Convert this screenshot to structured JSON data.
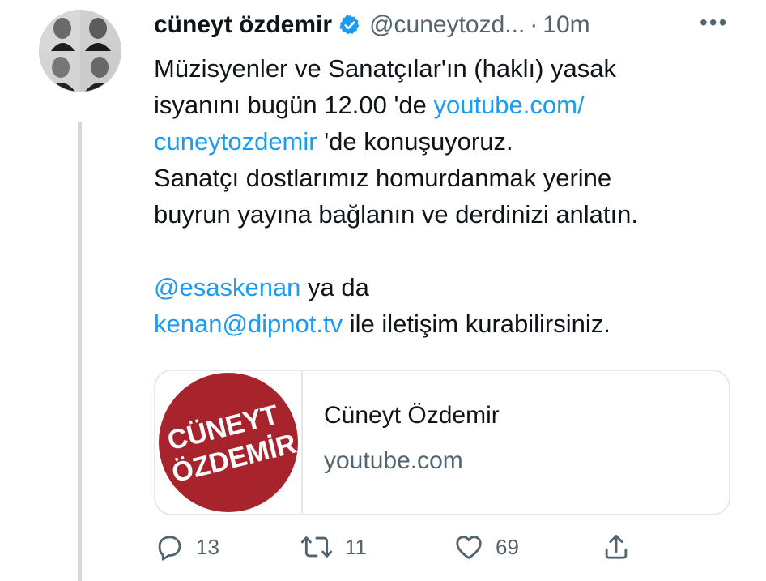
{
  "tweet": {
    "name": "cüneyt özdemir",
    "handle": "@cuneytozd...",
    "separator": "·",
    "time": "10m",
    "more": "•••",
    "text": {
      "l1": "Müzisyenler ve Sanatçılar'ın (haklı) yasak",
      "l2_pre": "isyanını bugün 12.00 'de ",
      "l2_link": "youtube.com/",
      "l3_link": "cuneytozdemir",
      "l3_post": " 'de konuşuyoruz.",
      "l4": "Sanatçı dostlarımız homurdanmak yerine",
      "l5": "buyrun yayına bağlanın ve derdinizi anlatın.",
      "l7_link": "@esaskenan",
      "l7_post": " ya da",
      "l8_link": "kenan@dipnot.tv",
      "l8_post": " ile iletişim kurabilirsiniz."
    },
    "card": {
      "logo_line1": "CÜNEYT",
      "logo_line2": "ÖZDEMİR",
      "title": "Cüneyt Özdemir",
      "domain": "youtube.com"
    },
    "actions": {
      "reply_count": "13",
      "retweet_count": "11",
      "like_count": "69"
    }
  },
  "icons": {
    "verified": "verified-badge-icon",
    "reply": "reply-icon",
    "retweet": "retweet-icon",
    "like": "heart-icon",
    "share": "share-icon"
  },
  "colors": {
    "link": "#1d9bf0",
    "secondary": "#536471",
    "logo_red": "#a8242d"
  }
}
